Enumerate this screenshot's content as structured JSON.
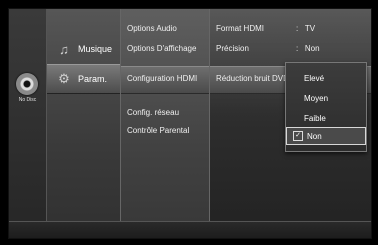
{
  "device": {
    "disc_status": "No Disc"
  },
  "categories": [
    {
      "label": "Musique",
      "icon": "music-note-icon"
    },
    {
      "label": "Param.",
      "icon": "gear-icon"
    }
  ],
  "submenu": [
    "Options Audio",
    "Options D'affichage",
    "Configuration HDMI",
    "Config. réseau",
    "Contrôle Parental"
  ],
  "details": [
    {
      "label": "Format HDMI",
      "sep": ":",
      "value": "TV"
    },
    {
      "label": "Précision",
      "sep": ":",
      "value": "Non"
    },
    {
      "label": "Réduction bruit DVD",
      "sep": "",
      "value": ""
    }
  ],
  "dropdown": {
    "options": [
      "Elevé",
      "Moyen",
      "Faible",
      "Non"
    ],
    "selected": "Non",
    "check_glyph": "✓"
  }
}
